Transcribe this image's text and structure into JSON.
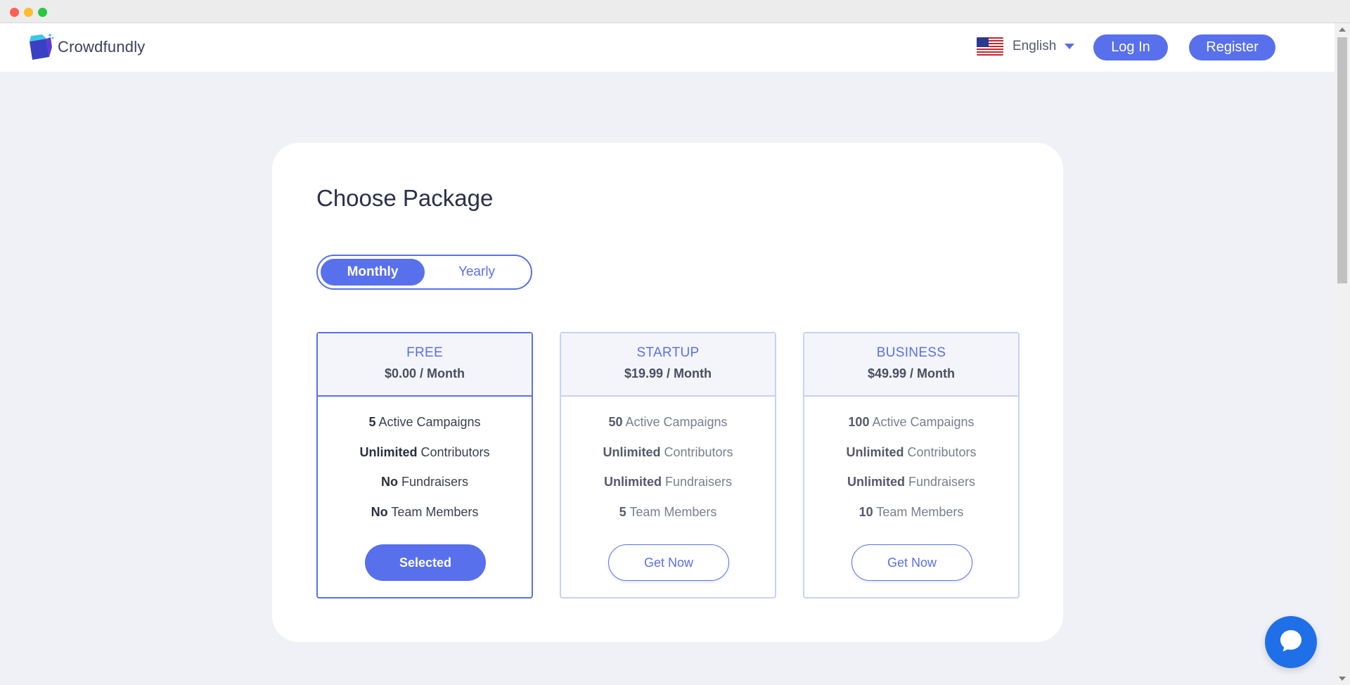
{
  "header": {
    "brand": "Crowdfundly",
    "language": "English",
    "login_label": "Log In",
    "register_label": "Register"
  },
  "page": {
    "title": "Choose Package",
    "billing_toggle": {
      "options": [
        "Monthly",
        "Yearly"
      ],
      "selected": "Monthly"
    }
  },
  "plans": [
    {
      "name": "FREE",
      "price": "$0.00 / Month",
      "features": [
        {
          "value": "5",
          "label": "Active Campaigns"
        },
        {
          "value": "Unlimited",
          "label": "Contributors"
        },
        {
          "value": "No",
          "label": "Fundraisers"
        },
        {
          "value": "No",
          "label": "Team Members"
        }
      ],
      "button": "Selected",
      "selected": true
    },
    {
      "name": "STARTUP",
      "price": "$19.99 / Month",
      "features": [
        {
          "value": "50",
          "label": "Active Campaigns"
        },
        {
          "value": "Unlimited",
          "label": "Contributors"
        },
        {
          "value": "Unlimited",
          "label": "Fundraisers"
        },
        {
          "value": "5",
          "label": "Team Members"
        }
      ],
      "button": "Get Now",
      "selected": false
    },
    {
      "name": "BUSINESS",
      "price": "$49.99 / Month",
      "features": [
        {
          "value": "100",
          "label": "Active Campaigns"
        },
        {
          "value": "Unlimited",
          "label": "Contributors"
        },
        {
          "value": "Unlimited",
          "label": "Fundraisers"
        },
        {
          "value": "10",
          "label": "Team Members"
        }
      ],
      "button": "Get Now",
      "selected": false
    }
  ],
  "colors": {
    "accent": "#5870ec",
    "chat": "#1f6fe8",
    "background": "#f0f1f6"
  },
  "icons": {
    "logo": "crowdfundly-logo-icon",
    "flag": "us-flag-icon",
    "caret": "chevron-down-icon",
    "chat": "chat-bubble-icon"
  }
}
